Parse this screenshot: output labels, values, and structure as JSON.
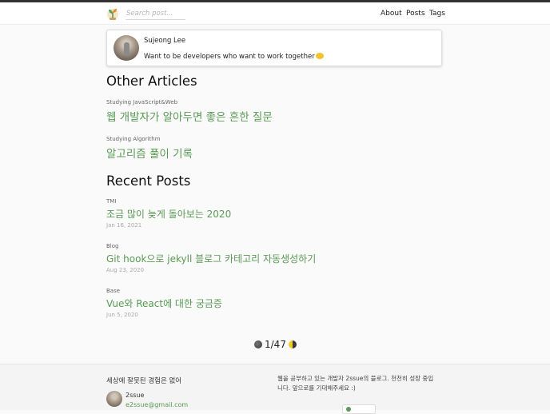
{
  "header": {
    "search_placeholder": "Search post...",
    "nav": [
      "About",
      "Posts",
      "Tags"
    ]
  },
  "profile": {
    "name": "Sujeong Lee",
    "bio": "Want to be developers who want to work together"
  },
  "other_articles": {
    "heading": "Other Articles",
    "items": [
      {
        "category": "Studying JavaScript&Web",
        "title": "웹 개발자가 알아두면 좋은 흔한 질문"
      },
      {
        "category": "Studying Algorithm",
        "title": "알고리즘 풀이 기록"
      }
    ]
  },
  "recent_posts": {
    "heading": "Recent Posts",
    "items": [
      {
        "category": "TMI",
        "title": "조금 많이 늦게 돌아보는 2020",
        "date": "Jan 16, 2021"
      },
      {
        "category": "Blog",
        "title": "Git hook으로 jekyll 블로그 카테고리 자동생성하기",
        "date": "Aug 23, 2020"
      },
      {
        "category": "Base",
        "title": "Vue와 React에 대한 궁금증",
        "date": "Jun 5, 2020"
      }
    ]
  },
  "pagination": {
    "label": "1/47"
  },
  "footer": {
    "title": "세상에 잘못된 경험은 없어",
    "name": "2ssue",
    "email": "e2ssue@gmail.com",
    "description": "웹을 공부하고 있는 개발자 2ssue의 블로그. 천천히 성장 중입니다. 앞으로를 기대해주세요 :)"
  },
  "colors": {
    "accent": "#5a9a55",
    "text": "#222222",
    "background": "#fafafa"
  },
  "icons": {
    "logo": "sprout-logo-icon",
    "prev": "new-moon-icon",
    "next": "half-moon-icon",
    "bio_emoji": "hugging-face-icon"
  }
}
